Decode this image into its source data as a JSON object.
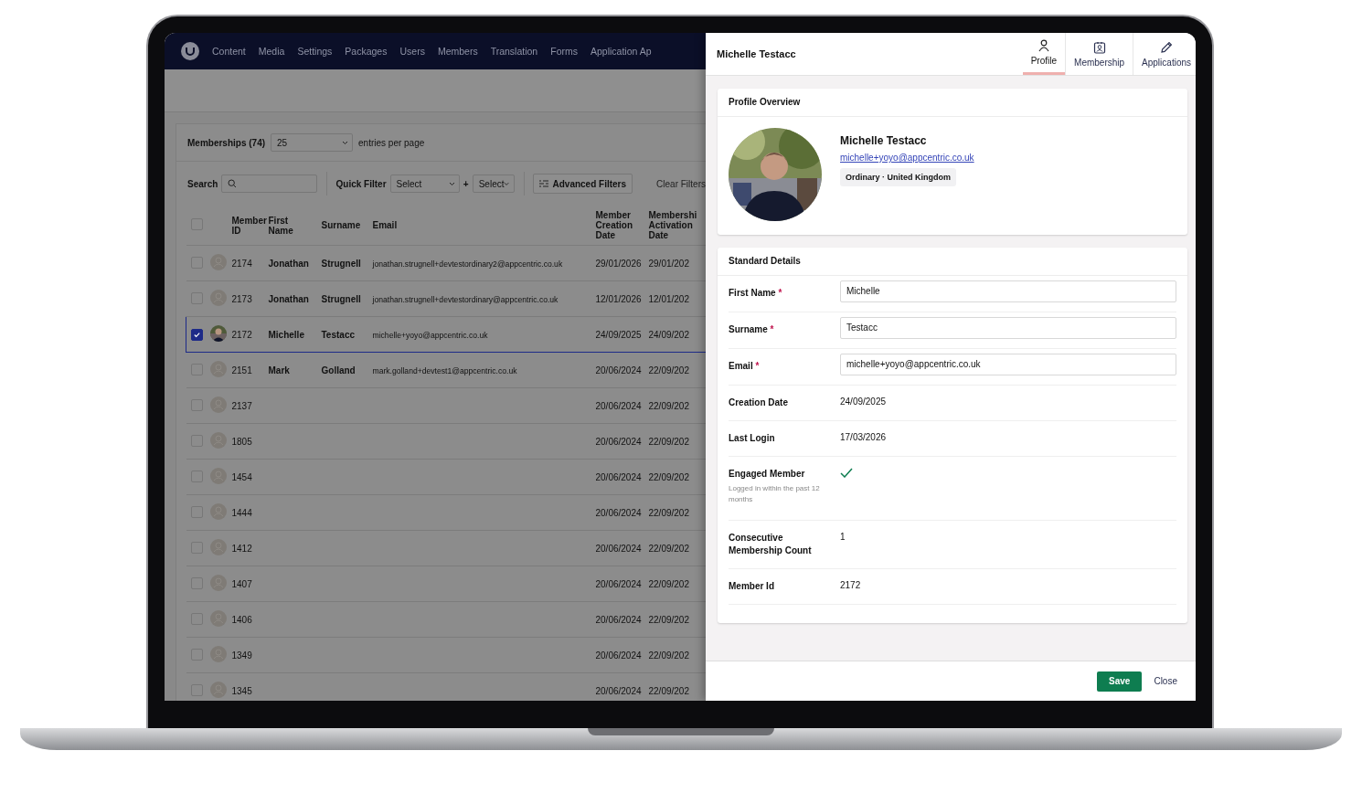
{
  "nav": {
    "items": [
      "Content",
      "Media",
      "Settings",
      "Packages",
      "Users",
      "Members",
      "Translation",
      "Forms",
      "Application Ap"
    ]
  },
  "list": {
    "title": "Memberships (74)",
    "page_size": "25",
    "page_size_suffix": "entries per page",
    "search": {
      "label": "Search"
    },
    "quick_filter": {
      "label": "Quick Filter",
      "select_1": "Select",
      "plus": "+",
      "select_2": "Select"
    },
    "advanced_filters": "Advanced Filters",
    "clear_filters": "Clear Filters",
    "columns": [
      {
        "lines": [
          "Member",
          "ID"
        ]
      },
      {
        "lines": [
          "First",
          "Name"
        ]
      },
      {
        "lines": [
          "Surname"
        ]
      },
      {
        "lines": [
          "Email"
        ]
      },
      {
        "lines": [
          "Member",
          "Creation",
          "Date"
        ]
      },
      {
        "lines": [
          "Membershi",
          "Activation",
          "Date"
        ]
      }
    ],
    "header_checked": false,
    "rows": [
      {
        "checked": false,
        "selected": false,
        "kind": "placeholder",
        "id": "2174",
        "first": "Jonathan",
        "surname": "Strugnell",
        "email": "jonathan.strugnell+devtestordinary2@appcentric.co.uk",
        "created": "29/01/2026",
        "activated": "29/01/202"
      },
      {
        "checked": false,
        "selected": false,
        "kind": "placeholder",
        "id": "2173",
        "first": "Jonathan",
        "surname": "Strugnell",
        "email": "jonathan.strugnell+devtestordinary@appcentric.co.uk",
        "created": "12/01/2026",
        "activated": "12/01/202"
      },
      {
        "checked": true,
        "selected": true,
        "id": "2172",
        "first": "Michelle",
        "surname": "Testacc",
        "email": "michelle+yoyo@appcentric.co.uk",
        "created": "24/09/2025",
        "activated": "24/09/202"
      },
      {
        "checked": false,
        "selected": false,
        "kind": "placeholder",
        "id": "2151",
        "first": "Mark",
        "surname": "Golland",
        "email": "mark.golland+devtest1@appcentric.co.uk",
        "created": "20/06/2024",
        "activated": "22/09/202"
      },
      {
        "checked": false,
        "selected": false,
        "kind": "placeholder",
        "id": "2137",
        "created": "20/06/2024",
        "activated": "22/09/202"
      },
      {
        "checked": false,
        "selected": false,
        "kind": "placeholder",
        "id": "1805",
        "created": "20/06/2024",
        "activated": "22/09/202"
      },
      {
        "checked": false,
        "selected": false,
        "kind": "placeholder",
        "id": "1454",
        "created": "20/06/2024",
        "activated": "22/09/202"
      },
      {
        "checked": false,
        "selected": false,
        "kind": "placeholder",
        "id": "1444",
        "created": "20/06/2024",
        "activated": "22/09/202"
      },
      {
        "checked": false,
        "selected": false,
        "kind": "placeholder",
        "id": "1412",
        "created": "20/06/2024",
        "activated": "22/09/202"
      },
      {
        "checked": false,
        "selected": false,
        "kind": "placeholder",
        "id": "1407",
        "created": "20/06/2024",
        "activated": "22/09/202"
      },
      {
        "checked": false,
        "selected": false,
        "kind": "placeholder",
        "id": "1406",
        "created": "20/06/2024",
        "activated": "22/09/202"
      },
      {
        "checked": false,
        "selected": false,
        "kind": "placeholder",
        "id": "1349",
        "created": "20/06/2024",
        "activated": "22/09/202"
      },
      {
        "checked": false,
        "selected": false,
        "kind": "placeholder",
        "id": "1345",
        "created": "20/06/2024",
        "activated": "22/09/202"
      }
    ]
  },
  "panel": {
    "title": "Michelle Testacc",
    "tabs": [
      {
        "label": "Profile",
        "selected": true
      },
      {
        "label": "Membership",
        "selected": false
      },
      {
        "label": "Applications",
        "selected": false
      }
    ],
    "overview": {
      "heading": "Profile Overview",
      "name": "Michelle Testacc",
      "email": "michelle+yoyo@appcentric.co.uk",
      "tag": "Ordinary · United Kingdom"
    },
    "details": {
      "heading": "Standard Details",
      "rows": [
        {
          "kind": "input",
          "label": "First Name",
          "required_mark": "*",
          "value": "Michelle"
        },
        {
          "kind": "input",
          "label": "Surname",
          "required_mark": "*",
          "value": "Testacc"
        },
        {
          "kind": "input",
          "label": "Email",
          "required_mark": "*",
          "value": "michelle+yoyo@appcentric.co.uk"
        },
        {
          "kind": "text",
          "label": "Creation Date",
          "value": "24/09/2025"
        },
        {
          "kind": "text",
          "label": "Last Login",
          "value": "17/03/2026"
        },
        {
          "kind": "check",
          "label": "Engaged Member",
          "hint": "Logged in within the past 12 months",
          "checked": true
        },
        {
          "kind": "text",
          "label": "Consecutive Membership Count",
          "value": "1"
        },
        {
          "kind": "text",
          "label": "Member Id",
          "value": "2172"
        }
      ]
    },
    "buttons": {
      "save": "Save",
      "close": "Close"
    }
  }
}
